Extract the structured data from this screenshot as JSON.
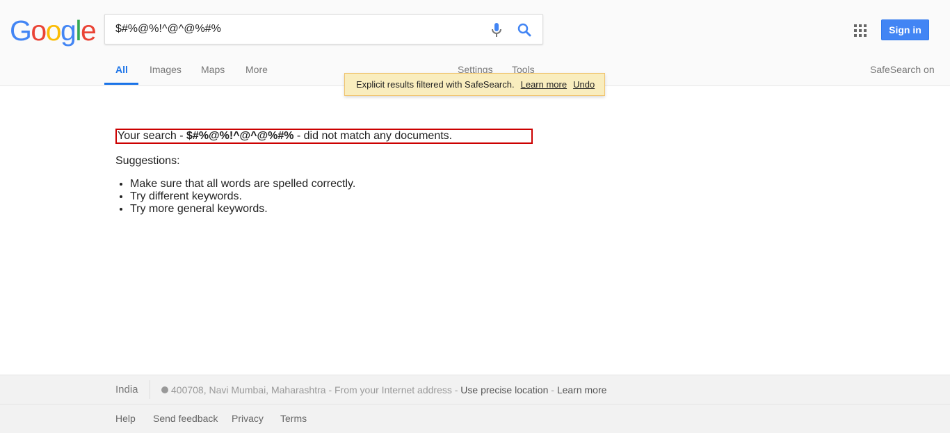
{
  "logo": {
    "letters": [
      "G",
      "o",
      "o",
      "g",
      "l",
      "e"
    ],
    "colors": [
      "#4285f4",
      "#ea4335",
      "#fbbc05",
      "#4285f4",
      "#34a853",
      "#ea4335"
    ]
  },
  "search": {
    "query": "$#%@%!^@^@%#%"
  },
  "header": {
    "sign_in": "Sign in"
  },
  "tabs": {
    "all": "All",
    "images": "Images",
    "maps": "Maps",
    "more": "More",
    "settings": "Settings",
    "tools": "Tools"
  },
  "safesearch": {
    "status": "SafeSearch on",
    "notice": "Explicit results filtered with SafeSearch.",
    "learn_more": "Learn more",
    "undo": "Undo"
  },
  "results": {
    "no_match_prefix": "Your search - ",
    "no_match_query": "$#%@%!^@^@%#%",
    "no_match_suffix": " - did not match any documents.",
    "suggestions_title": "Suggestions:",
    "suggestions": [
      "Make sure that all words are spelled correctly.",
      "Try different keywords.",
      "Try more general keywords."
    ]
  },
  "footer": {
    "country": "India",
    "location": "400708, Navi Mumbai, Maharashtra",
    "from_text": " - From your Internet address - ",
    "precise": "Use precise location",
    "sep": " - ",
    "learn_more": "Learn more",
    "links": {
      "help": "Help",
      "feedback": "Send feedback",
      "privacy": "Privacy",
      "terms": "Terms"
    }
  },
  "colors": {
    "accent": "#1a73e8",
    "signin_bg": "#4285f4",
    "notice_bg": "#f9edbe",
    "highlight_border": "#cc0000"
  }
}
